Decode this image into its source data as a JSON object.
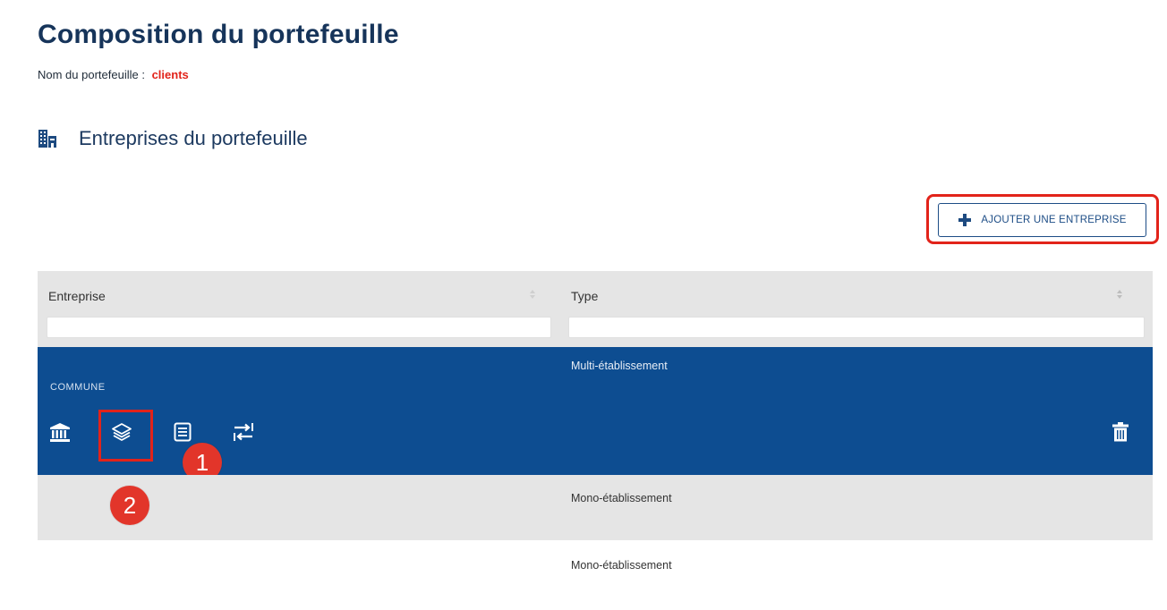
{
  "page": {
    "title": "Composition du portefeuille",
    "portfolio_name_label": "Nom du portefeuille :",
    "portfolio_name_value": "clients",
    "section_title": "Entreprises du portefeuille"
  },
  "actions": {
    "add_company_label": "AJOUTER UNE ENTREPRISE",
    "add_icon": "plus-icon"
  },
  "table": {
    "columns": [
      "Entreprise",
      "Type"
    ],
    "filters": [
      "",
      ""
    ],
    "rows": [
      {
        "company": "COMMUNE",
        "type": "Multi-établissement",
        "selected": true,
        "actions": [
          "bank-icon",
          "layers-icon",
          "document-icon",
          "swap-icon",
          "trash-icon"
        ]
      },
      {
        "company": "",
        "type": "Mono-établissement"
      },
      {
        "company": "",
        "type": "Mono-établissement"
      }
    ]
  },
  "annotations": {
    "badge_1": "1",
    "badge_2": "2"
  },
  "colors": {
    "primary": "#0d4d91",
    "title": "#16345a",
    "highlight": "#e2231a",
    "header_bg": "#e5e5e5"
  }
}
